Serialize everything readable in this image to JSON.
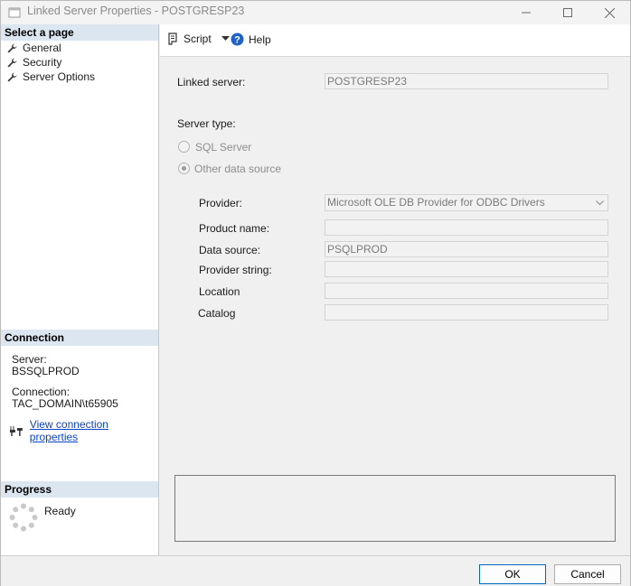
{
  "window": {
    "title": "Linked Server Properties - POSTGRESP23"
  },
  "left": {
    "select_header": "Select a page",
    "pages": [
      "General",
      "Security",
      "Server Options"
    ],
    "connection_header": "Connection",
    "server_label": "Server:",
    "server_value": "BSSQLPROD",
    "connection_label": "Connection:",
    "connection_value": "TAC_DOMAIN\\t65905",
    "view_link": "View connection properties",
    "progress_header": "Progress",
    "progress_status": "Ready"
  },
  "toolbar": {
    "script_label": "Script",
    "help_label": "Help"
  },
  "general": {
    "linked_server_label": "Linked server:",
    "linked_server_value": "POSTGRESP23",
    "server_type_label": "Server type:",
    "sql_server_label": "SQL Server",
    "other_source_label": "Other data source",
    "provider_label": "Provider:",
    "provider_value": "Microsoft OLE DB Provider for ODBC Drivers",
    "product_name_label": "Product name:",
    "product_name_value": "",
    "data_source_label": "Data source:",
    "data_source_value": "PSQLPROD",
    "provider_string_label": "Provider string:",
    "provider_string_value": "",
    "location_label": "Location",
    "location_value": "",
    "catalog_label": "Catalog",
    "catalog_value": ""
  },
  "footer": {
    "ok_label": "OK",
    "cancel_label": "Cancel"
  }
}
